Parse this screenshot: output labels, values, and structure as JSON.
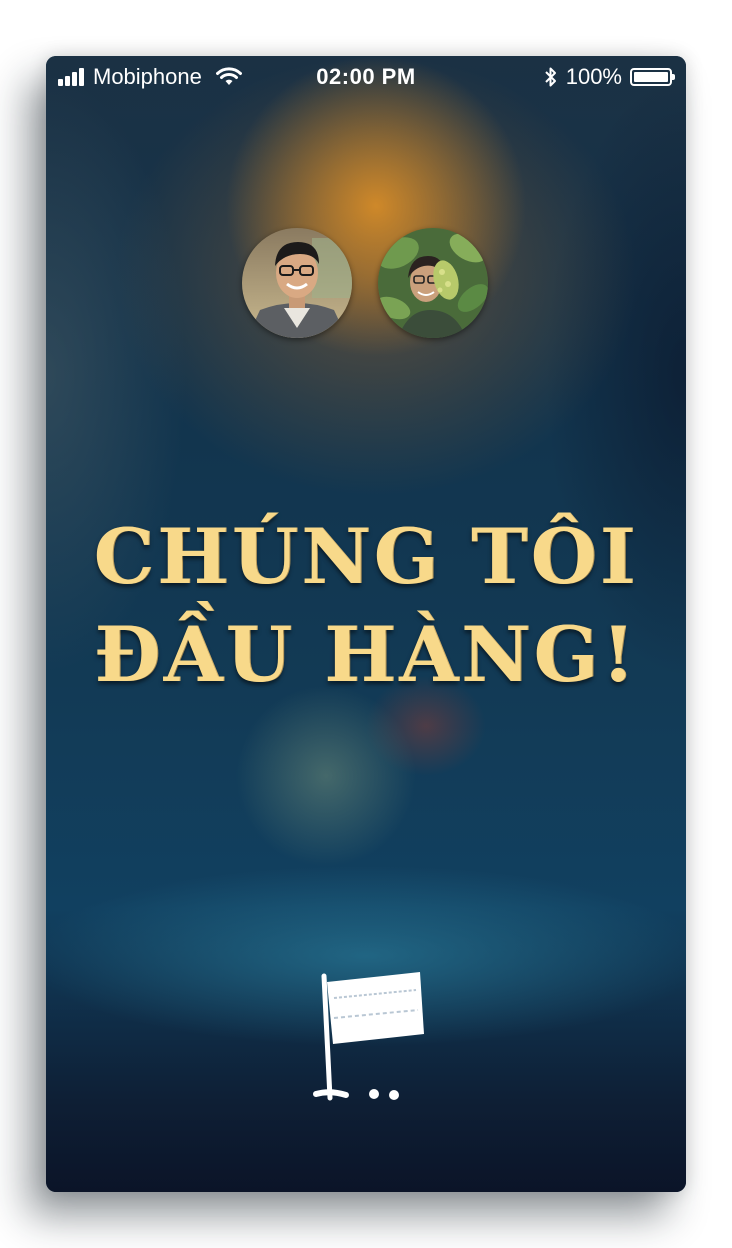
{
  "status_bar": {
    "carrier": "Mobiphone",
    "time": "02:00 PM",
    "battery_percent": "100%",
    "battery_level": 1.0,
    "signal_bars": 4,
    "icons": [
      "signal-icon",
      "wifi-icon",
      "bluetooth-icon",
      "battery-icon"
    ]
  },
  "avatars": [
    {
      "name": "avatar-man-glasses"
    },
    {
      "name": "avatar-woman-leaves"
    }
  ],
  "headline": {
    "line1": "Chúng tôi",
    "line2": "đầu hàng!"
  },
  "surrender_icon": "white-flag-icon",
  "colors": {
    "headline": "#f8d98a",
    "background_top": "#1b3144",
    "glow": "#d68c28",
    "background_bottom": "#0b1428"
  }
}
